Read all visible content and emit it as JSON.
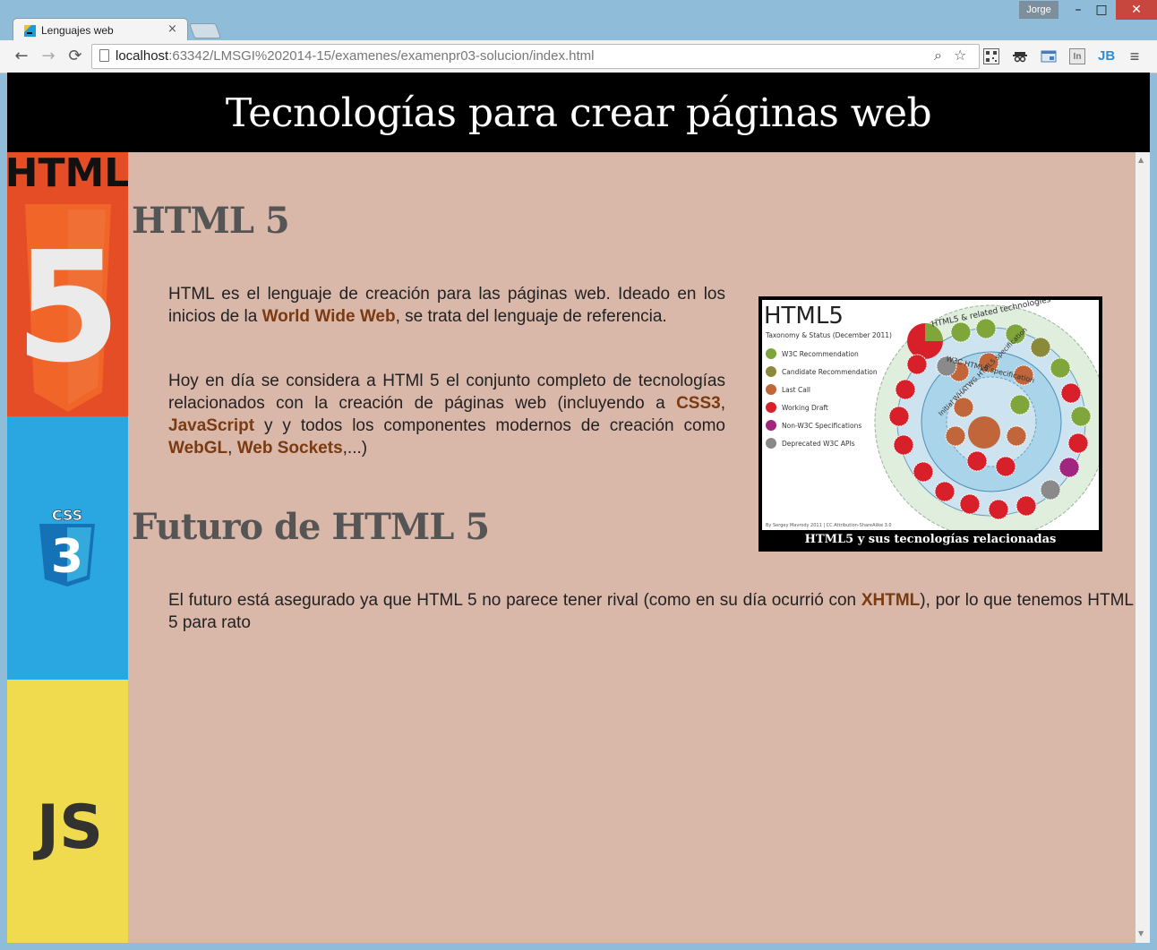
{
  "window": {
    "user": "Jorge",
    "minimize": "–",
    "maximize": "□",
    "close": "✕"
  },
  "tab": {
    "title": "Lenguajes web",
    "close": "×"
  },
  "toolbar": {
    "back": "←",
    "forward": "→",
    "reload": "⟳",
    "url_host": "localhost",
    "url_rest": ":63342/LMSGI%202014-15/examenes/examenpr03-solucion/index.html",
    "search_icon": "⌕",
    "star_icon": "☆",
    "ext_in": "In",
    "ext_jb": "JB",
    "menu": "≡"
  },
  "page": {
    "title": "Tecnologías para crear páginas web",
    "section1": {
      "heading": "HTML 5",
      "p1_a": "HTML es el lenguaje de creación para las páginas web. Ideado en los inicios de la ",
      "p1_link": "World Wide Web",
      "p1_b": ", se trata del lenguaje de referencia.",
      "p2_a": "Hoy en día se considera a HTMl 5 el conjunto completo de tecnologías relacionados con la creación de páginas web (incluyendo a ",
      "p2_link1": "CSS3",
      "p2_sep1": ", ",
      "p2_link2": "JavaScript",
      "p2_mid": " y y todos los componentes modernos de creación como ",
      "p2_link3": "WebGL",
      "p2_sep2": ", ",
      "p2_link4": "Web Sockets",
      "p2_end": ",...)"
    },
    "section2": {
      "heading": "Futuro de HTML 5",
      "p_a": "El futuro está asegurado ya que HTML 5 no parece tener rival (como en su día ocurrió con ",
      "p_link": "XHTML",
      "p_b": "), por lo que tenemos HTML 5 para rato"
    },
    "figure": {
      "caption": "HTML5 y sus tecnologías relacionadas",
      "img_title": "HTML5",
      "img_subtitle": "Taxonomy & Status (December 2011)",
      "legend": [
        {
          "label": "W3C Recommendation",
          "color": "#7fa63a"
        },
        {
          "label": "Candidate Recommendation",
          "color": "#8a8a3a"
        },
        {
          "label": "Last Call",
          "color": "#c0663a"
        },
        {
          "label": "Working Draft",
          "color": "#d8202a"
        },
        {
          "label": "Non-W3C Specifications",
          "color": "#a0267f"
        },
        {
          "label": "Deprecated W3C APIs",
          "color": "#8a8a8a"
        }
      ],
      "ring1": "HTML5 & related technologies",
      "ring2": "W3C HTML5 specification",
      "ring3": "Initial WHATWG HTML5 specification",
      "credit": "By Sergey Mavrody 2011 | CC Attribution-ShareAlike 3.0"
    },
    "sidebar": {
      "html_label": "HTML",
      "html_num": "5",
      "css_label": "CSS",
      "css_num": "3",
      "js_label": "JS"
    },
    "colors": {
      "bg": "#d9b7a9",
      "link": "#7a3a12",
      "html": "#e44d26",
      "css": "#2aa6e0",
      "js": "#f0db4f"
    }
  }
}
